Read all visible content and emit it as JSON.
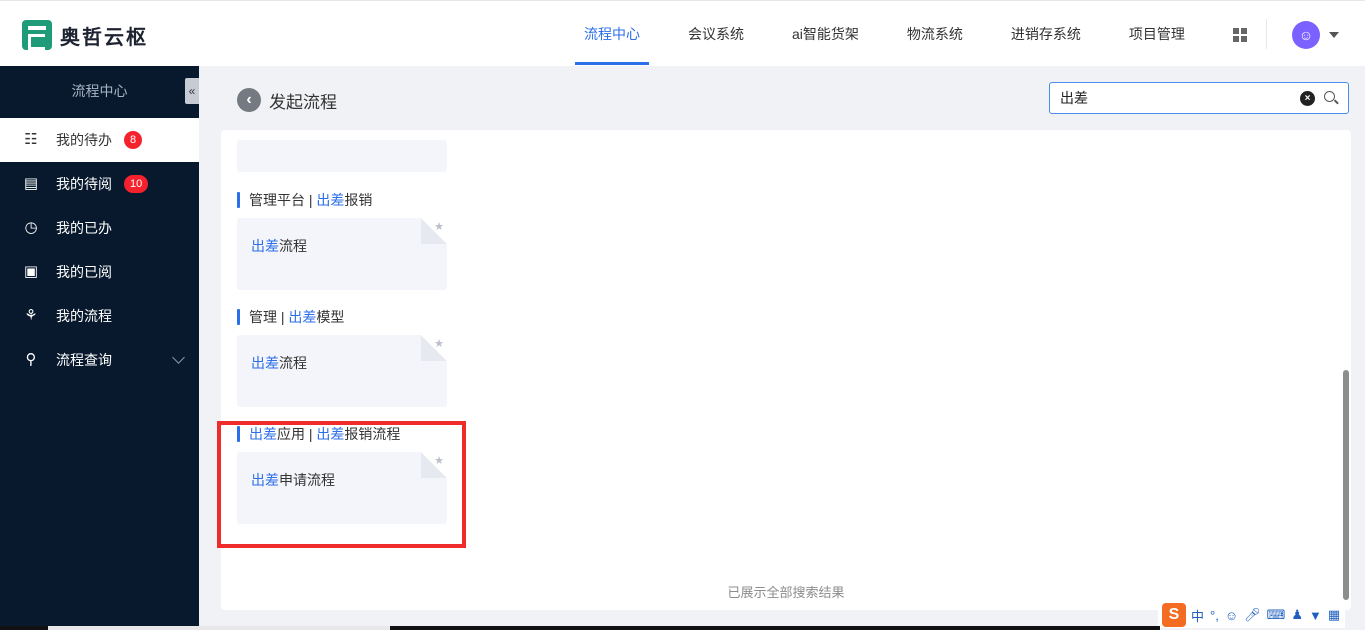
{
  "app": {
    "name": "奥哲云枢"
  },
  "nav": {
    "items": [
      "流程中心",
      "会议系统",
      "ai智能货架",
      "物流系统",
      "进销存系统",
      "项目管理"
    ],
    "active": 0
  },
  "sidebar": {
    "title": "流程中心",
    "collapse_icon": "«",
    "items": [
      {
        "label": "我的待办",
        "badge": "8",
        "icon": "todo-list-icon"
      },
      {
        "label": "我的待阅",
        "badge": "10",
        "icon": "to-read-icon"
      },
      {
        "label": "我的已办",
        "badge": "",
        "icon": "done-clock-icon"
      },
      {
        "label": "我的已阅",
        "badge": "",
        "icon": "read-doc-icon"
      },
      {
        "label": "我的流程",
        "badge": "",
        "icon": "org-chart-icon"
      },
      {
        "label": "流程查询",
        "badge": "",
        "icon": "search-icon"
      }
    ]
  },
  "page": {
    "title": "发起流程",
    "search": {
      "value": "出差"
    }
  },
  "groups": [
    {
      "title_parts": [
        {
          "text": "管理平台 | ",
          "hl": false
        },
        {
          "text": "出差",
          "hl": true
        },
        {
          "text": "报销",
          "hl": false
        }
      ],
      "card": [
        {
          "text": "出差",
          "hl": true
        },
        {
          "text": "流程",
          "hl": false
        }
      ]
    },
    {
      "title_parts": [
        {
          "text": "管理 | ",
          "hl": false
        },
        {
          "text": "出差",
          "hl": true
        },
        {
          "text": "模型",
          "hl": false
        }
      ],
      "card": [
        {
          "text": "出差",
          "hl": true
        },
        {
          "text": "流程",
          "hl": false
        }
      ]
    },
    {
      "title_parts": [
        {
          "text": "出差",
          "hl": true
        },
        {
          "text": "应用 | ",
          "hl": false
        },
        {
          "text": "出差",
          "hl": true
        },
        {
          "text": "报销流程",
          "hl": false
        }
      ],
      "card": [
        {
          "text": "出差",
          "hl": true
        },
        {
          "text": "申请流程",
          "hl": false
        }
      ]
    }
  ],
  "end_text": "已展示全部搜索结果",
  "ime": {
    "logo": "S",
    "mode": "中",
    "punct": "°,"
  },
  "colors": {
    "accent": "#2c6fea",
    "sidebar_bg": "#08192e",
    "badge": "#f5222d",
    "highlight_box": "#ef2b2b"
  }
}
